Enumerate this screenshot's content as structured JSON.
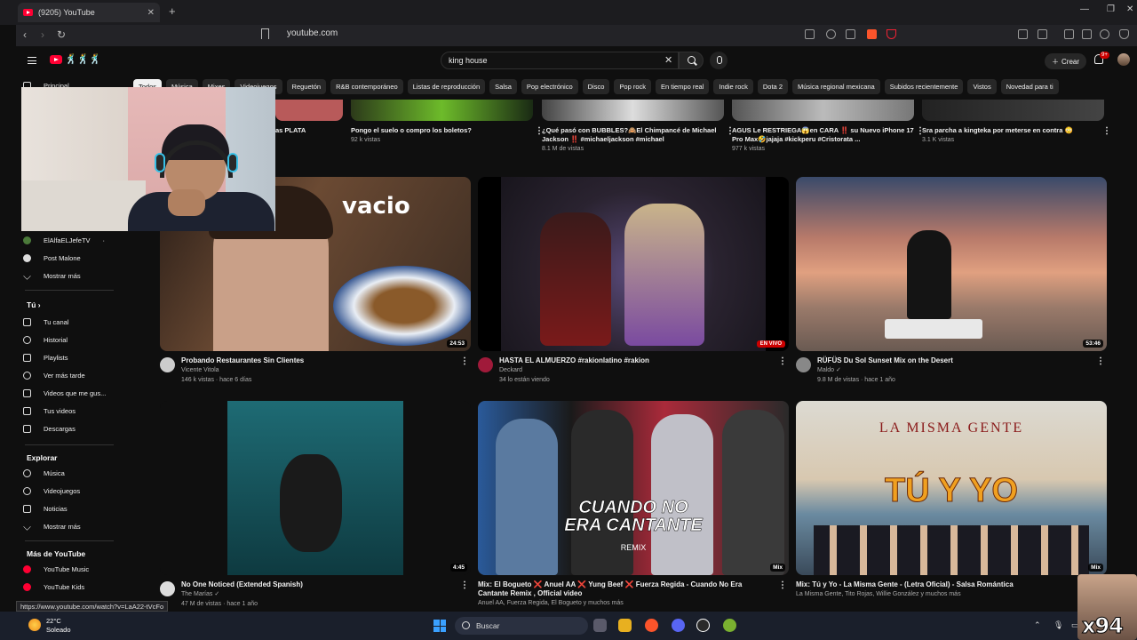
{
  "browser": {
    "tab_title": "(9205) YouTube",
    "url": "youtube.com"
  },
  "header": {
    "search_value": "king house",
    "create_label": "Crear",
    "notifications_badge": "9+"
  },
  "chips": [
    "Todos",
    "Música",
    "Mixes",
    "Videojuegos",
    "Reguetón",
    "R&B contemporáneo",
    "Listas de reproducción",
    "Salsa",
    "Pop electrónico",
    "Disco",
    "Pop rock",
    "En tiempo real",
    "Indie rock",
    "Dota 2",
    "Música regional mexicana",
    "Subidos recientemente",
    "Vistos",
    "Novedad para ti"
  ],
  "sidebar": {
    "home": "Principal",
    "subs": [
      {
        "label": "ElAlfaELJefeTV",
        "dot": "·"
      },
      {
        "label": "Post Malone"
      }
    ],
    "show_more": "Mostrar más",
    "you_head": "Tú",
    "you_items": [
      "Tu canal",
      "Historial",
      "Playlists",
      "Ver más tarde",
      "Videos que me gus...",
      "Tus videos",
      "Descargas"
    ],
    "explore_head": "Explorar",
    "explore_items": [
      "Música",
      "Videojuegos",
      "Noticias"
    ],
    "explore_more": "Mostrar más",
    "more_head": "Más de YouTube",
    "more_items": [
      "YouTube Music",
      "YouTube Kids"
    ]
  },
  "top_row": [
    {
      "title": "as PLATA",
      "sub": ""
    },
    {
      "title": "Pongo el suelo o compro los boletos?",
      "sub": "92 k vistas"
    },
    {
      "title": "¿Qué pasó con BUBBLES?🙈El Chimpancé de Michael Jackson ‼️ #michaeljackson #michael",
      "sub": "8.1 M de vistas"
    },
    {
      "title": "AGUS Le RESTRIEGA😱en CARA ‼️ su Nuevo iPhone 17 Pro Max🤣jajaja #kickperu #Cristorata ...",
      "sub": "977 k vistas"
    },
    {
      "title": "Sra parcha a kingteka por meterse en contra 😳",
      "sub": "3.1 K vistas"
    }
  ],
  "videos": [
    {
      "thumb_text": "vacio",
      "duration": "24:53",
      "title": "Probando Restaurantes Sin Clientes",
      "channel": "Vicente Vitola",
      "stats": "146 k vistas · hace 6 días"
    },
    {
      "live": "EN VIVO",
      "title": "HASTA EL ALMUERZO #rakionlatino #rakion",
      "channel": "Deckard",
      "stats": "34 lo están viendo"
    },
    {
      "duration": "53:46",
      "title": "RÜFÜS Du Sol Sunset Mix on the Desert",
      "channel": "Maldo ✓",
      "stats": "9.8 M de vistas · hace 1 año"
    },
    {
      "duration": "4:45",
      "title": "No One Noticed (Extended Spanish)",
      "channel": "The Marías ✓",
      "stats": "47 M de vistas · hace 1 año"
    },
    {
      "thumb_text": "CUANDO NO ERA CANTANTE",
      "thumb_sub": "REMIX",
      "duration": "Mix",
      "title": "Mix: El Bogueto ❌ Anuel AA ❌ Yung Beef ❌ Fuerza Regida - Cuando No Era Cantante Remix , Official video",
      "channel": "Anuel AA, Fuerza Regida, El Bogueto y muchos más",
      "stats": ""
    },
    {
      "thumb_text": "LA MISMA GENTE",
      "thumb_sub": "TÚ Y YO",
      "duration": "Mix",
      "title": "Mix: Tú y Yo - La Misma Gente - (Letra Oficial) - Salsa Romántica",
      "channel": "La Misma Gente, Tito Rojas, Willie González y muchos más",
      "stats": ""
    }
  ],
  "status_url": "https://www.youtube.com/watch?v=LaA22-tVcFo",
  "taskbar": {
    "temp": "22°C",
    "weather": "Soleado",
    "search": "Buscar"
  },
  "watermark": "x94",
  "colors": {
    "accent": "#ff0033",
    "bg": "#0f0f0f",
    "live": "#cc0000"
  }
}
